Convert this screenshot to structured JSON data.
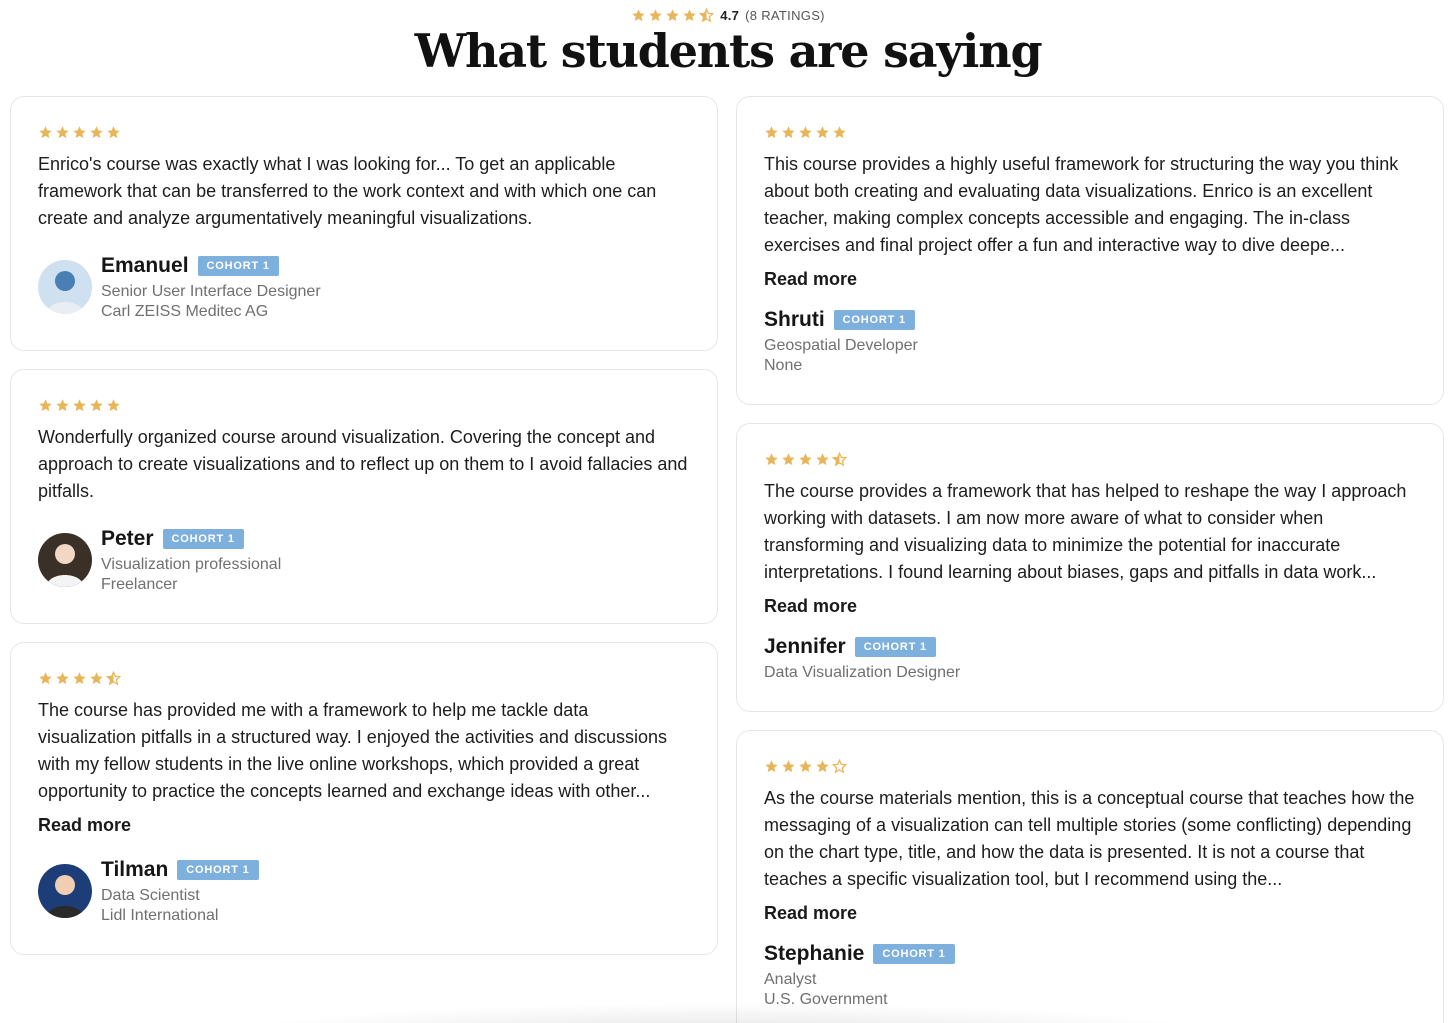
{
  "summary": {
    "rating": "4.7",
    "count_text": "(8 RATINGS)",
    "stars": 4.5
  },
  "title": "What students are saying",
  "colors": {
    "star": "#e8b65a",
    "badge": "#7db0dc"
  },
  "left_reviews": [
    {
      "stars": 5,
      "text": "Enrico's course was exactly what I was looking for... To get an applicable framework that can be transferred to the work context and with which one can create and analyze argumentatively meaningful visualizations.",
      "read_more": "",
      "name": "Emanuel",
      "cohort": "COHORT 1",
      "role": "Senior User Interface Designer",
      "company": "Carl ZEISS Meditec AG",
      "avatar": "avatar-photo-emanuel"
    },
    {
      "stars": 5,
      "text": "Wonderfully organized course around visualization. Covering the concept and approach to create visualizations and to reflect up on them to I avoid fallacies and pitfalls.",
      "read_more": "",
      "name": "Peter",
      "cohort": "COHORT 1",
      "role": "Visualization professional",
      "company": "Freelancer",
      "avatar": "avatar-photo-peter"
    },
    {
      "stars": 4.5,
      "text": "The course has provided me with a framework to help me tackle data visualization pitfalls in a structured way. I enjoyed the activities and discussions with my fellow students in the live online workshops, which provided a great opportunity to practice the concepts learned and exchange ideas with other...",
      "read_more": "Read more",
      "name": "Tilman",
      "cohort": "COHORT 1",
      "role": "Data Scientist",
      "company": "Lidl International",
      "avatar": "avatar-photo-tilman"
    }
  ],
  "right_reviews": [
    {
      "stars": 5,
      "text": "This course provides a highly useful framework for structuring the way you think about both creating and evaluating data visualizations. Enrico is an excellent teacher, making complex concepts accessible and engaging. The in-class exercises and final project offer a fun and interactive way to dive deepe...",
      "read_more": "Read more",
      "name": "Shruti",
      "cohort": "COHORT 1",
      "role": "Geospatial Developer",
      "company": "None"
    },
    {
      "stars": 4.5,
      "text": "The course provides a framework that has helped to reshape the way I approach working with datasets. I am now more aware of what to consider when transforming and visualizing data to minimize the potential for inaccurate interpretations. I found learning about biases, gaps and pitfalls in data work...",
      "read_more": "Read more",
      "name": "Jennifer",
      "cohort": "COHORT 1",
      "role": "Data Visualization Designer",
      "company": ""
    },
    {
      "stars": 4,
      "text": "As the course materials mention, this is a conceptual course that teaches how the messaging of a visualization can tell multiple stories (some conflicting) depending on the chart type, title, and how the data is presented. It is not a course that teaches a specific visualization tool, but I recommend using the...",
      "read_more": "Read more",
      "name": "Stephanie",
      "cohort": "COHORT 1",
      "role": "Analyst",
      "company": "U.S. Government"
    }
  ]
}
